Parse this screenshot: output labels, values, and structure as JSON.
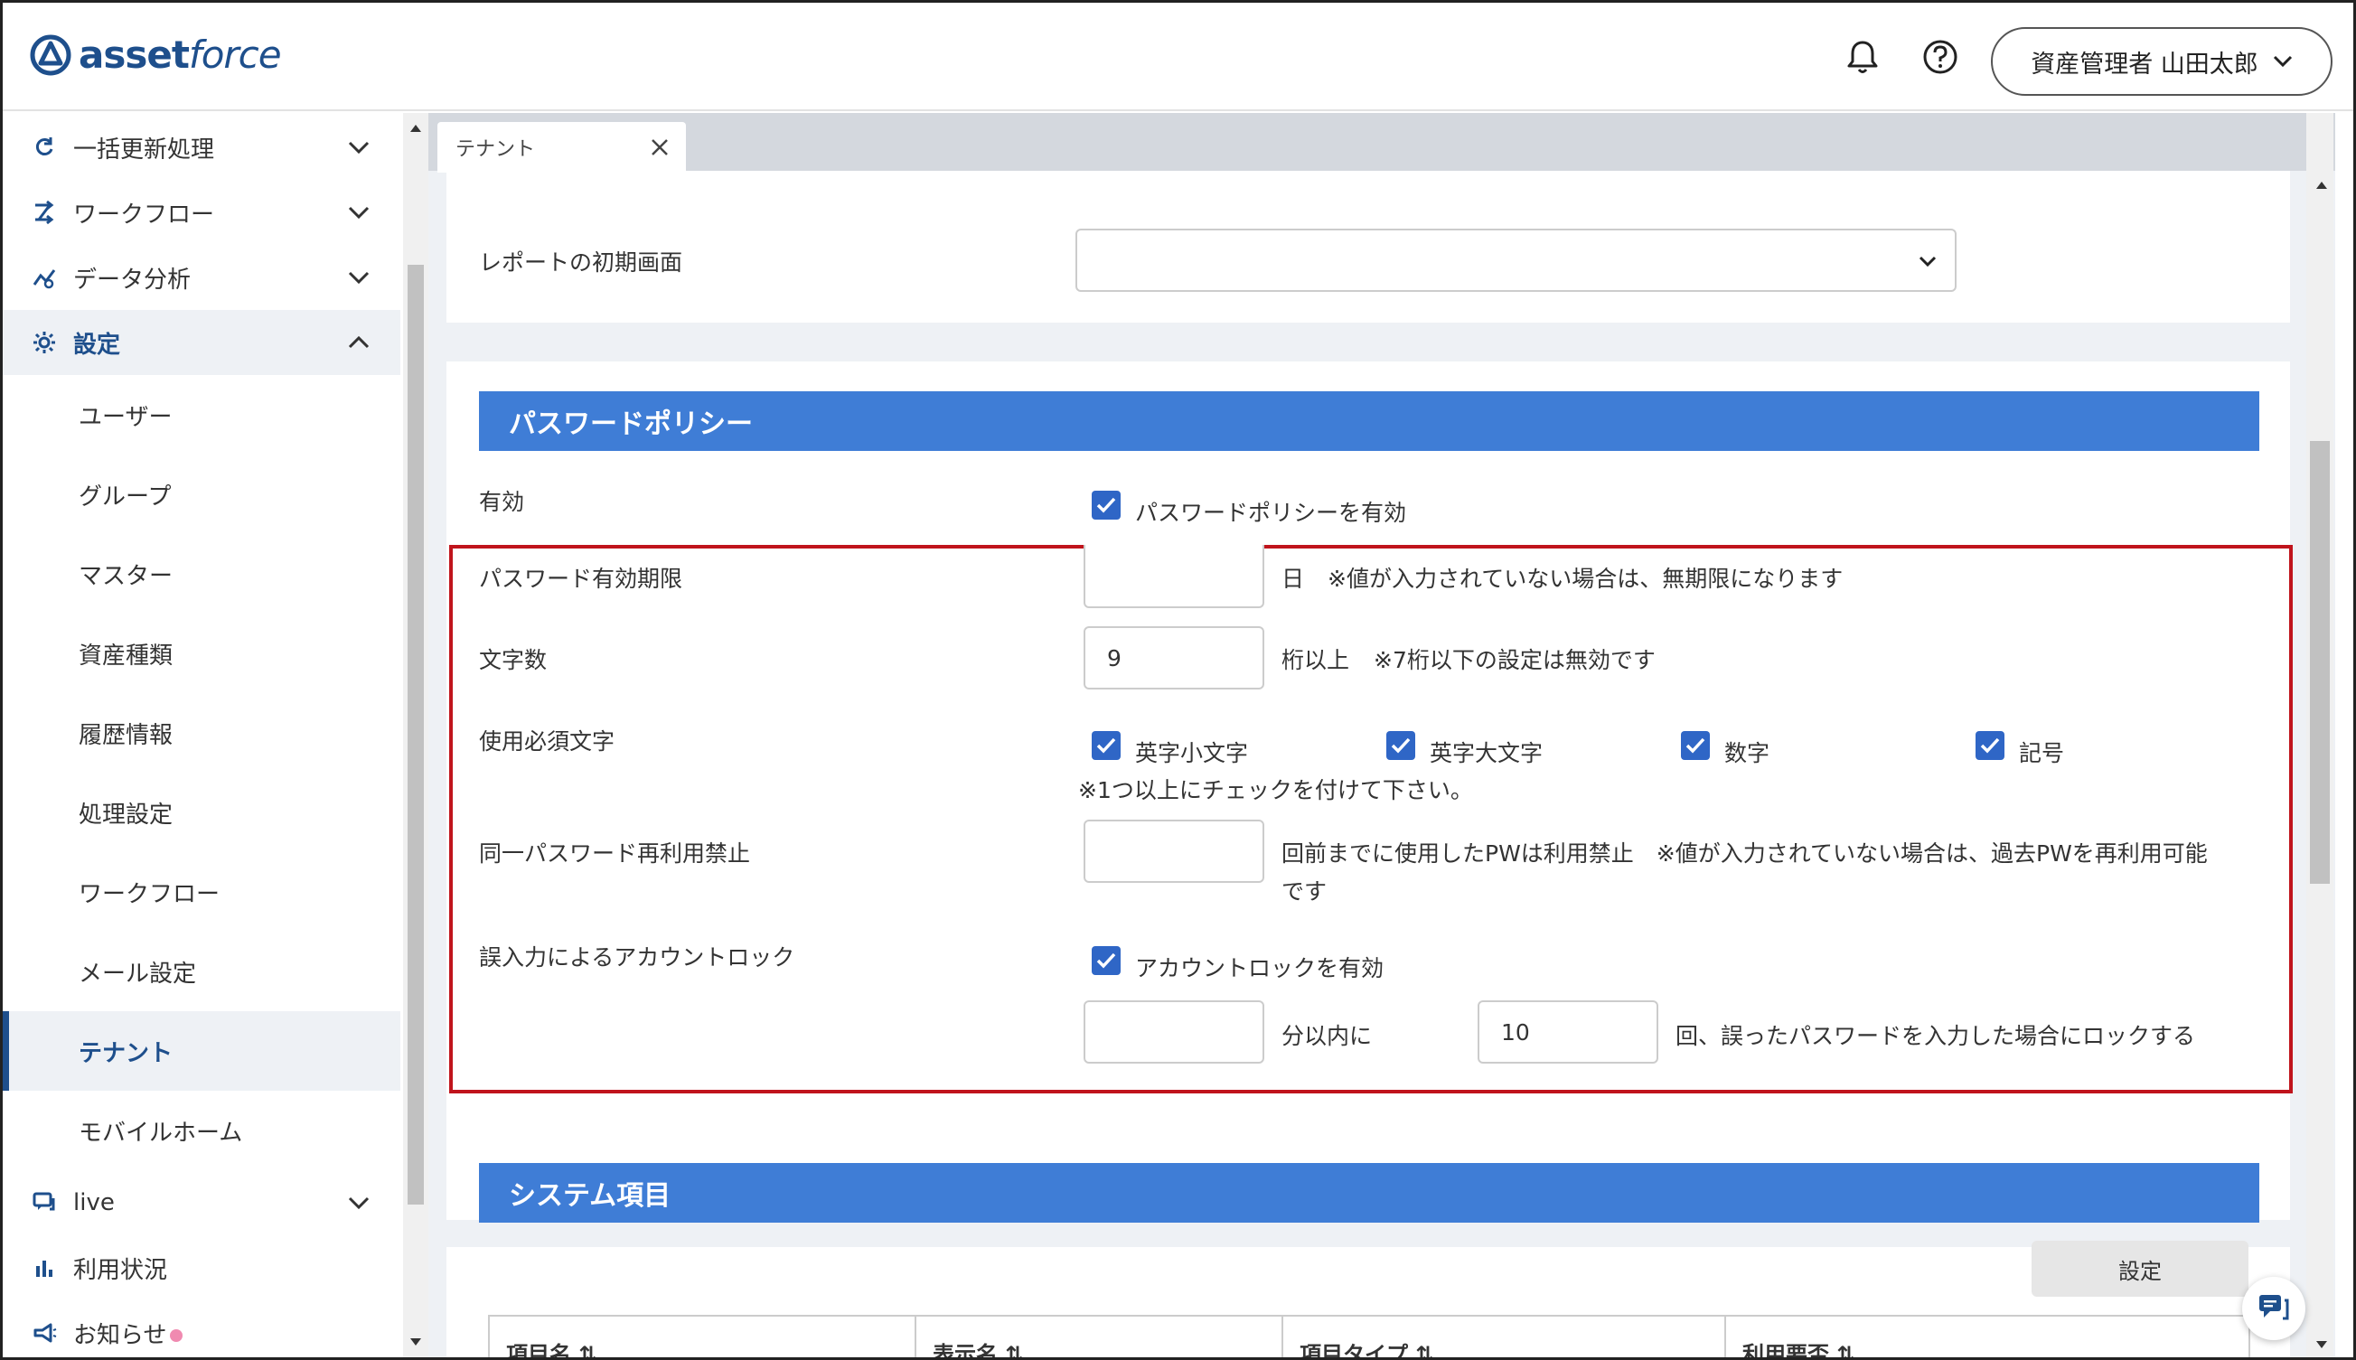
{
  "header": {
    "logo_word1": "asset",
    "logo_word2": "force",
    "user_label": "資産管理者 山田太郎"
  },
  "sidebar": {
    "groups": [
      {
        "label": "一括更新処理",
        "icon": "refresh-icon"
      },
      {
        "label": "ワークフロー",
        "icon": "workflow-icon"
      },
      {
        "label": "データ分析",
        "icon": "analytics-icon"
      },
      {
        "label": "設定",
        "icon": "gear-icon"
      }
    ],
    "settings_items": [
      "ユーザー",
      "グループ",
      "マスター",
      "資産種類",
      "履歴情報",
      "処理設定",
      "ワークフロー",
      "メール設定",
      "テナント",
      "モバイルホーム"
    ],
    "selected_item": "テナント",
    "bottom": [
      {
        "label": "live",
        "icon": "chat-icon"
      },
      {
        "label": "利用状況",
        "icon": "bar-chart-icon"
      },
      {
        "label": "お知らせ",
        "icon": "megaphone-icon"
      }
    ]
  },
  "tabs": [
    {
      "label": "テナント"
    }
  ],
  "report": {
    "label": "レポートの初期画面",
    "value": ""
  },
  "password_policy": {
    "title": "パスワードポリシー",
    "enabled_label": "有効",
    "enabled_checkbox_label": "パスワードポリシーを有効",
    "enabled_checked": true,
    "expiry_label": "パスワード有効期限",
    "expiry_value": "",
    "expiry_unit": "日",
    "expiry_note": "※値が入力されていない場合は、無期限になります",
    "length_label": "文字数",
    "length_value": "9",
    "length_unit": "桁以上",
    "length_note": "※7桁以下の設定は無効です",
    "required_label": "使用必須文字",
    "required_options": [
      {
        "label": "英字小文字",
        "checked": true
      },
      {
        "label": "英字大文字",
        "checked": true
      },
      {
        "label": "数字",
        "checked": true
      },
      {
        "label": "記号",
        "checked": true
      }
    ],
    "required_note": "※1つ以上にチェックを付けて下さい。",
    "reuse_label": "同一パスワード再利用禁止",
    "reuse_value": "",
    "reuse_note_line1": "回前までに使用したPWは利用禁止　※値が入力されていない場合は、過去PWを再利用可能",
    "reuse_note_line2": "です",
    "lock_label": "誤入力によるアカウントロック",
    "lock_checkbox_label": "アカウントロックを有効",
    "lock_checked": true,
    "lock_minutes_value": "",
    "lock_minutes_unit": "分以内に",
    "lock_count_value": "10",
    "lock_count_note": "回、誤ったパスワードを入力した場合にロックする"
  },
  "system_items": {
    "title": "システム項目",
    "button_label": "設定",
    "columns": [
      "項目名",
      "表示名",
      "項目タイプ",
      "利用要否"
    ]
  },
  "colors": {
    "brand": "#1e4f8c",
    "section_header": "#3f7dd6",
    "checkbox": "#2f66c6",
    "highlight": "#c0141c"
  }
}
